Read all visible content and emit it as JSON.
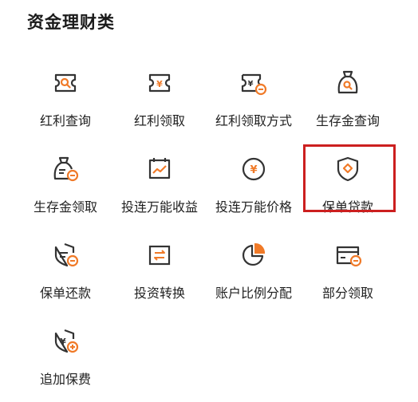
{
  "section_title": "资金理财类",
  "highlight_color": "#cc1f1f",
  "accent_color": "#f07a28",
  "items": [
    {
      "label": "红利查询",
      "icon": "bonus-query-icon"
    },
    {
      "label": "红利领取",
      "icon": "bonus-claim-icon"
    },
    {
      "label": "红利领取方式",
      "icon": "bonus-claim-method-icon"
    },
    {
      "label": "生存金查询",
      "icon": "survival-fund-query-icon"
    },
    {
      "label": "生存金领取",
      "icon": "survival-fund-claim-icon"
    },
    {
      "label": "投连万能收益",
      "icon": "investment-yield-icon"
    },
    {
      "label": "投连万能价格",
      "icon": "investment-price-icon"
    },
    {
      "label": "保单贷款",
      "icon": "policy-loan-icon"
    },
    {
      "label": "保单还款",
      "icon": "policy-repayment-icon"
    },
    {
      "label": "投资转换",
      "icon": "investment-switch-icon"
    },
    {
      "label": "账户比例分配",
      "icon": "account-allocation-icon"
    },
    {
      "label": "部分领取",
      "icon": "partial-withdrawal-icon"
    },
    {
      "label": "追加保费",
      "icon": "additional-premium-icon"
    }
  ]
}
